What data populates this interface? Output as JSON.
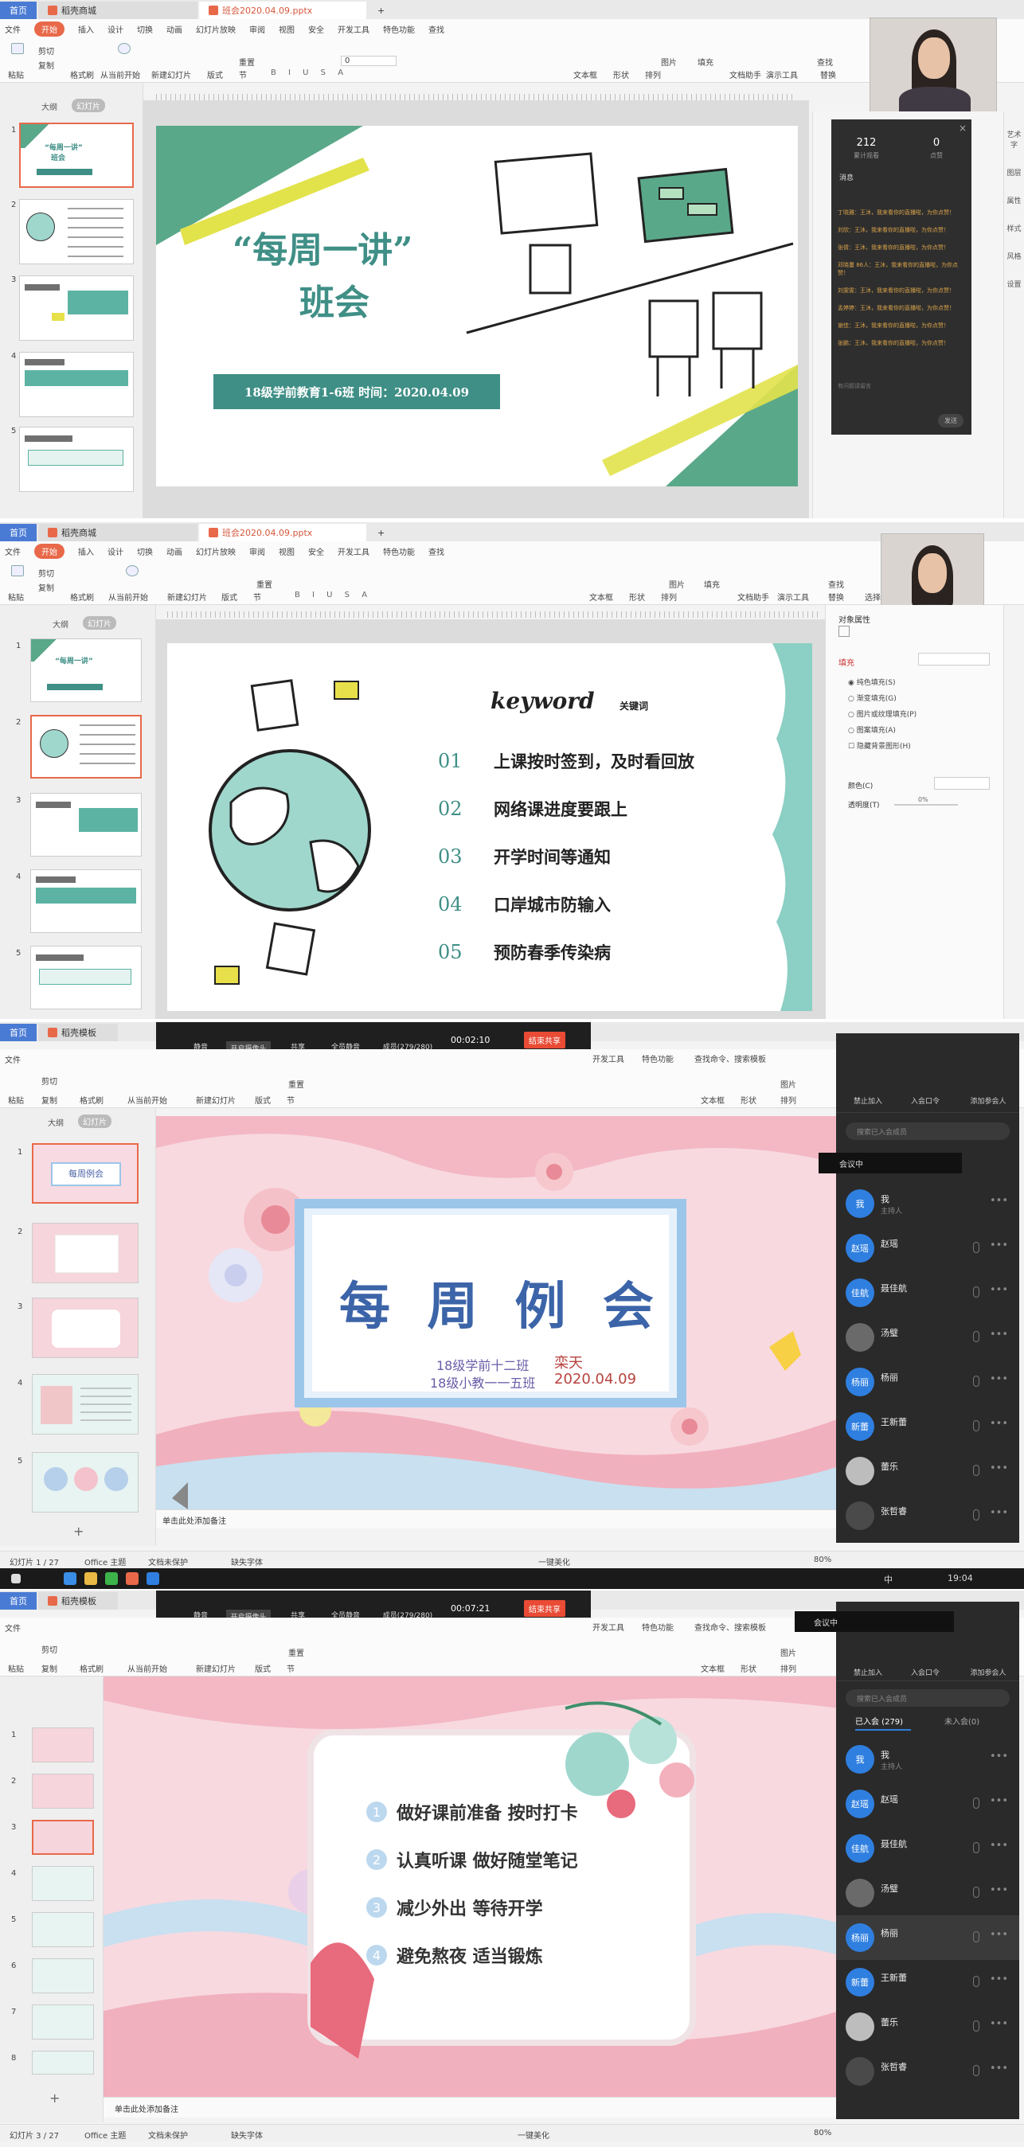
{
  "tabs": {
    "home": "首页",
    "store": "稻壳商城",
    "file1": "班会2020.04.09.pptx",
    "template": "稻壳模板",
    "plus": "+"
  },
  "menu": {
    "file": "文件",
    "start": "开始",
    "insert": "插入",
    "design": "设计",
    "transition": "切换",
    "animation": "动画",
    "slideshow": "幻灯片放映",
    "review": "审阅",
    "view": "视图",
    "security": "安全",
    "dev": "开发工具",
    "special": "特色功能",
    "search": "查找",
    "search_cmd": "查找命令、搜索模板"
  },
  "ribbon": {
    "cut": "剪切",
    "copy": "复制",
    "paste": "粘贴",
    "format": "格式刷",
    "from_start": "从当前开始",
    "new_slide": "新建幻灯片",
    "layout": "版式",
    "section": "节",
    "reset": "重置",
    "textbox": "文本框",
    "shape": "形状",
    "arrange": "排列",
    "picture": "图片",
    "fill": "填充",
    "find": "查找",
    "replace": "替换",
    "assistant": "文档助手",
    "show": "演示工具",
    "select": "选择",
    "font_size": "0"
  },
  "outline": {
    "tab_outline": "大纲",
    "tab_slides": "幻灯片"
  },
  "panel1": {
    "stats": [
      {
        "value": "212",
        "label": "累计观看"
      },
      {
        "value": "0",
        "label": "点赞"
      }
    ],
    "msg_title": "消息",
    "messages": [
      "丁晓雅：王沐，我来看你的直播啦，为你点赞！",
      "刘欣：王沐，我来看你的直播啦，为你点赞！",
      "张倩：王沐，我来看你的直播啦，为你点赞！",
      "邓晓蔓 86人：王沐，我来看你的直播啦，为你点赞！",
      "刘雯雯：王沐，我来看你的直播啦，为你点赞！",
      "孟婷婷：王沐，我来看你的直播啦，为你点赞！",
      "谢佳：王沐，我来看你的直播啦，为你点赞！",
      "张鹏：王沐，我来看你的直播啦，为你点赞！"
    ],
    "input_hint": "有问题请留言",
    "send": "发送"
  },
  "slide1": {
    "quote": "“每周一讲”",
    "title": "班会",
    "banner": "18级学前教育1-6班    时间：2020.04.09"
  },
  "slide2": {
    "keyword": "keyword",
    "keyword_cn": "关键词",
    "items": [
      {
        "num": "01",
        "text": "上课按时签到，及时看回放"
      },
      {
        "num": "02",
        "text": "网络课进度要跟上"
      },
      {
        "num": "03",
        "text": "开学时间等通知"
      },
      {
        "num": "04",
        "text": "口岸城市防输入"
      },
      {
        "num": "05",
        "text": "预防春季传染病"
      }
    ]
  },
  "props": {
    "title": "对象属性",
    "fill": "填充",
    "opts": [
      "纯色填充(S)",
      "渐变填充(G)",
      "图片或纹理填充(P)",
      "图案填充(A)",
      "隐藏背景图形(H)"
    ],
    "color": "颜色(C)",
    "transparency": "透明度(T)",
    "pct": "0%"
  },
  "meeting": {
    "mute": "静音",
    "camera": "开启摄像头",
    "share": "共享",
    "mute_all": "全员静音",
    "members": "成员(279/280)",
    "time3": "00:02:10",
    "time4": "00:07:21",
    "end": "结束共享",
    "in_meeting": "会议中",
    "invite": "禁止加入",
    "join_code": "入会口令",
    "add": "添加参会人",
    "search": "搜索已入会成员",
    "joined": "已入会 (279)",
    "not_joined": "未入会(0)",
    "host_sub": "主持人"
  },
  "members": [
    {
      "avatar": "我",
      "name": "我",
      "host": true,
      "color": "#2f7fe0"
    },
    {
      "avatar": "赵瑶",
      "name": "赵瑶",
      "color": "#2f7fe0"
    },
    {
      "avatar": "佳航",
      "name": "聂佳航",
      "color": "#2f7fe0"
    },
    {
      "avatar": "",
      "name": "汤璧",
      "color": "#6a6a6a"
    },
    {
      "avatar": "杨丽",
      "name": "杨丽",
      "color": "#2f7fe0"
    },
    {
      "avatar": "新蕾",
      "name": "王新蕾",
      "color": "#2f7fe0"
    },
    {
      "avatar": "",
      "name": "蕾乐",
      "color": "#bdbdbd"
    },
    {
      "avatar": "",
      "name": "张哲睿",
      "color": "#4a4a4a"
    }
  ],
  "slide3": {
    "title": "每 周 例 会",
    "sub1": "18级学前十二班",
    "sub2": "18级小教一一五班",
    "name": "栾天",
    "date": "2020.04.09"
  },
  "slide4": {
    "items": [
      {
        "num": "1",
        "text": "做好课前准备 按时打卡"
      },
      {
        "num": "2",
        "text": "认真听课 做好随堂笔记"
      },
      {
        "num": "3",
        "text": "减少外出 等待开学"
      },
      {
        "num": "4",
        "text": "避免熬夜 适当锻炼"
      }
    ]
  },
  "notes_hint": "单击此处添加备注",
  "status3": {
    "slide": "幻灯片 1 / 27",
    "theme": "Office 主题",
    "protect": "文档未保护",
    "font": "缺失字体",
    "beautify": "一键美化",
    "zoom": "80%"
  },
  "status4": {
    "slide": "幻灯片 3 / 27",
    "theme": "Office 主题",
    "protect": "文档未保护",
    "font": "缺失字体",
    "beautify": "一键美化",
    "zoom": "80%"
  },
  "taskbar": {
    "time": "19:04",
    "ime": "中"
  },
  "side_labels": [
    "艺术字",
    "图层",
    "属性",
    "样式",
    "风格",
    "设置"
  ]
}
